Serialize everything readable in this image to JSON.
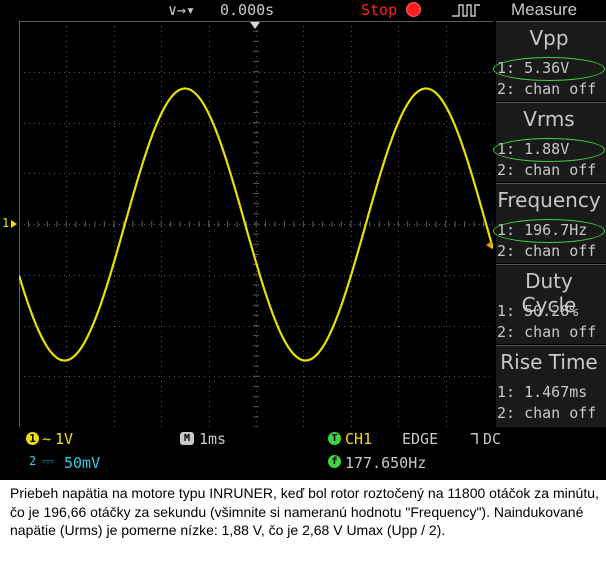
{
  "top_bar": {
    "trigger_position_icon": "trigger-position-icon",
    "time_offset": "0.000s",
    "run_state": "Stop",
    "run_state_color": "#ff2020",
    "trigger_edge_icon": "rising-edge-icon",
    "menu_title": "Measure"
  },
  "measurements": [
    {
      "title": "Vpp",
      "ch1": "1: 5.36V",
      "ch2": "2: chan off",
      "highlighted": true
    },
    {
      "title": "Vrms",
      "ch1": "1: 1.88V",
      "ch2": "2: chan off",
      "highlighted": true
    },
    {
      "title": "Frequency",
      "ch1": "1: 196.7Hz",
      "ch2": "2: chan off",
      "highlighted": true
    },
    {
      "title": "Duty Cycle",
      "ch1": "1: 50.28%",
      "ch2": "2: chan off",
      "highlighted": false
    },
    {
      "title": "Rise Time",
      "ch1": "1: 1.467ms",
      "ch2": "2: chan off",
      "highlighted": false
    }
  ],
  "status_bar": {
    "ch1_badge": "1",
    "ch1_coupling_icon": "ac-coupling-icon",
    "ch1_scale": "1V",
    "ch2_badge": "2",
    "ch2_coupling_icon": "dc-coupling-icon",
    "ch2_scale": "50mV",
    "timebase_badge": "M",
    "timebase": "1ms",
    "trigger_badge": "T",
    "trigger_source": "CH1",
    "trigger_type": "EDGE",
    "trigger_coupling_icon": "falling-edge-icon",
    "trigger_coupling": "DC",
    "freq_badge": "f",
    "trigger_frequency": "177.650Hz"
  },
  "markers": {
    "ch1_ground": "1",
    "ch1_ground_icon": "ch1-ground-marker-icon",
    "trigger_level_icon": "trigger-level-marker-icon",
    "trigger_time_icon": "trigger-time-marker-icon"
  },
  "waveform": {
    "channel": "CH1",
    "frequency_hz": 196.7,
    "amplitude_v": 2.68,
    "volts_per_div": 1,
    "time_per_div_ms": 1,
    "color": "#e8e000"
  },
  "colors": {
    "trace": "#e8e000",
    "measurement_ring": "#3fd43f",
    "ch1": "#f0e000",
    "ch2": "#33c8e8",
    "trigger_freq": "#3fd43f",
    "grid": "#5a5a5a"
  },
  "caption": "Priebeh napätia na motore typu INRUNER, keď bol rotor roztočený na 11800 otáčok za minútu, čo je 196,66 otáčky za sekundu (všimnite si nameranú hodnotu \"Frequency\"). Naindukované napätie (Urms) je pomerne nízke: 1,88 V, čo je 2,68 V Umax (Upp / 2)."
}
